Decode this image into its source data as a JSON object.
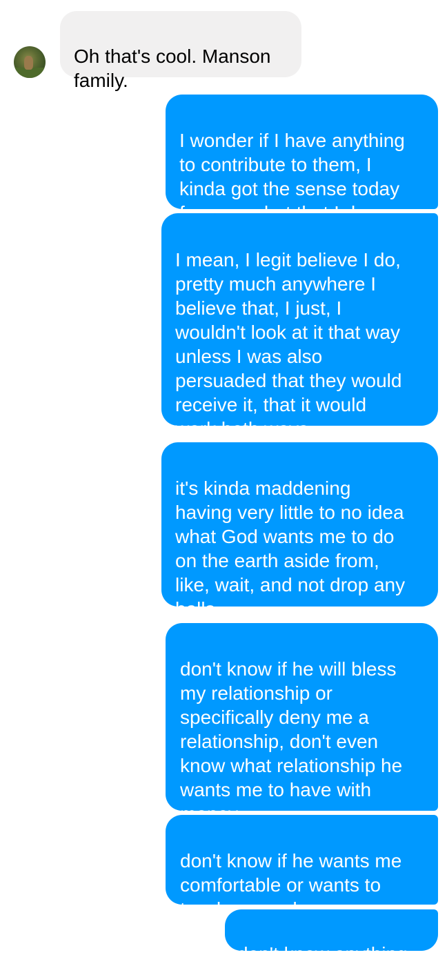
{
  "conversation": {
    "contact": {
      "avatar_icon": "profile-photo-avatar"
    },
    "colors": {
      "incoming_bubble": "#f1f0f0",
      "outgoing_bubble": "#0099ff",
      "incoming_text": "#000000",
      "outgoing_text": "#ffffff"
    },
    "messages": [
      {
        "direction": "incoming",
        "text": "Oh that's cool. Manson\nfamily."
      },
      {
        "direction": "outgoing",
        "text": "I wonder if I have anything\nto contribute to them, I\nkinda got the sense today\nfrom my chat that I do"
      },
      {
        "direction": "outgoing",
        "text": "I mean, I legit believe I do,\npretty much anywhere I\nbelieve that, I just, I\nwouldn't look at it that way\nunless I was also\npersuaded that they would\nreceive it, that it would\nwork both ways"
      },
      {
        "direction": "outgoing",
        "text": "it's kinda maddening\nhaving very little to no idea\nwhat God wants me to do\non the earth aside from,\nlike, wait, and not drop any\nballs"
      },
      {
        "direction": "outgoing",
        "text": "don't know if he will bless\nmy relationship or\nspecifically deny me a\nrelationship, don't even\nknow what relationship he\nwants me to have with\nmoney"
      },
      {
        "direction": "outgoing",
        "text": "don't know if he wants me\ncomfortable or wants to\nteach me endurance"
      },
      {
        "direction": "outgoing",
        "text": "don't know anything"
      }
    ]
  }
}
